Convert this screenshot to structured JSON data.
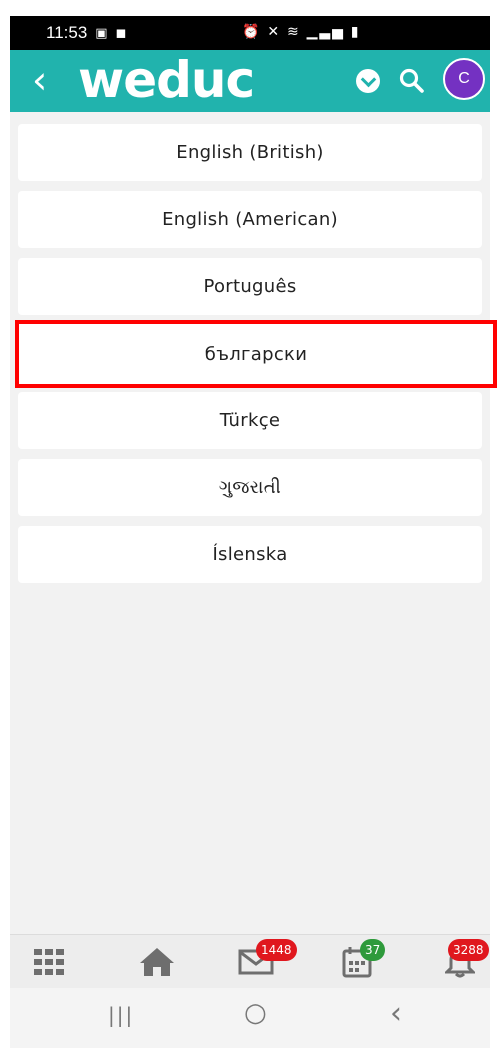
{
  "status_bar": {
    "time": "11:53",
    "left_icons": [
      "gallery-icon",
      "notification-icon"
    ],
    "right_icons": [
      "alarm-icon",
      "mute-icon",
      "wifi-icon",
      "signal-icon",
      "battery-icon"
    ]
  },
  "header": {
    "back_label": "‹",
    "logo": "weduc",
    "avatar_letter": "C",
    "colors": {
      "header_bg": "#21b3ad",
      "avatar_bg": "#7431c2"
    }
  },
  "languages": [
    {
      "label": "English (British)",
      "highlighted": false
    },
    {
      "label": "English (American)",
      "highlighted": false
    },
    {
      "label": "Português",
      "highlighted": false
    },
    {
      "label": "български",
      "highlighted": true
    },
    {
      "label": "Türkçe",
      "highlighted": false
    },
    {
      "label": "ગુજરાતી",
      "highlighted": false
    },
    {
      "label": "Íslenska",
      "highlighted": false
    }
  ],
  "bottom_nav": {
    "items": [
      {
        "icon": "apps-grid-icon",
        "badge": ""
      },
      {
        "icon": "home-icon",
        "badge": ""
      },
      {
        "icon": "messages-icon",
        "badge": "1448"
      },
      {
        "icon": "calendar-icon",
        "badge": "37"
      },
      {
        "icon": "notifications-bell-icon",
        "badge": "3288"
      }
    ],
    "colors": {
      "badge_red": "#e0171e",
      "badge_green": "#2e9a3b"
    }
  },
  "system_nav": {
    "recents": "|||",
    "home": "○",
    "back": "‹"
  }
}
